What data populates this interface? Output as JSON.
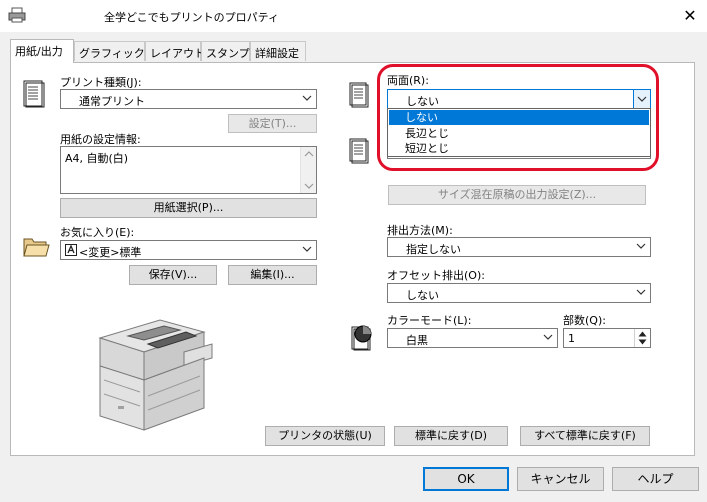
{
  "window": {
    "title": "全学どこでもプリントのプロパティ",
    "close_glyph": "✕"
  },
  "tabs": [
    {
      "label": "用紙/出力",
      "active": true
    },
    {
      "label": "グラフィックス"
    },
    {
      "label": "レイアウト"
    },
    {
      "label": "スタンプ"
    },
    {
      "label": "詳細設定"
    }
  ],
  "left": {
    "print_type_label": "プリント種類(J):",
    "print_type_value": "通常プリント",
    "settings_button": "設定(T)...",
    "paper_info_label": "用紙の設定情報:",
    "paper_info_value": "A4, 自動(白)",
    "paper_select_button": "用紙選択(P)...",
    "favorites_label": "お気に入り(E):",
    "favorites_value": "<変更>標準",
    "save_button": "保存(V)...",
    "edit_button": "編集(I)..."
  },
  "right": {
    "duplex_label": "両面(R):",
    "duplex_value": "しない",
    "duplex_options": [
      "しない",
      "長辺とじ",
      "短辺とじ"
    ],
    "mixed_size_button": "サイズ混在原稿の出力設定(Z)...",
    "output_method_label": "排出方法(M):",
    "output_method_value": "指定しない",
    "offset_label": "オフセット排出(O):",
    "offset_value": "しない",
    "color_mode_label": "カラーモード(L):",
    "color_mode_value": "白黒",
    "copies_label": "部数(Q):",
    "copies_value": "1"
  },
  "bottom_buttons": {
    "printer_status": "プリンタの状態(U)",
    "reset_default": "標準に戻す(D)",
    "reset_all": "すべて標準に戻す(F)"
  },
  "dialog_buttons": {
    "ok": "OK",
    "cancel": "キャンセル",
    "help": "ヘルプ"
  },
  "colors": {
    "highlight": "#e0102a",
    "selection": "#0078d7"
  }
}
